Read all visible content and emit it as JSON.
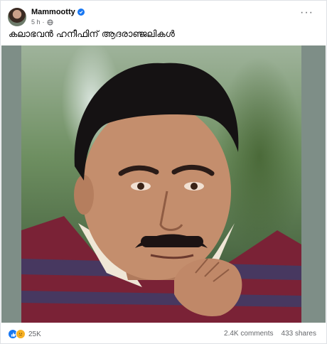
{
  "post": {
    "author": "Mammootty",
    "time": "5 h",
    "caption": "കലാഭവൻ ഹനീഫിന് ആദരാഞ്ജലികൾ"
  },
  "icons": {
    "verified": "verified-badge-icon",
    "audience": "globe-icon",
    "more": "more-options-icon",
    "like": "like-reaction-icon",
    "sad": "sad-reaction-icon"
  },
  "footer": {
    "reaction_count": "25K",
    "comments": "2.4K comments",
    "shares": "433 shares"
  },
  "colors": {
    "accent": "#1877f2",
    "secondary_text": "#65676b"
  }
}
